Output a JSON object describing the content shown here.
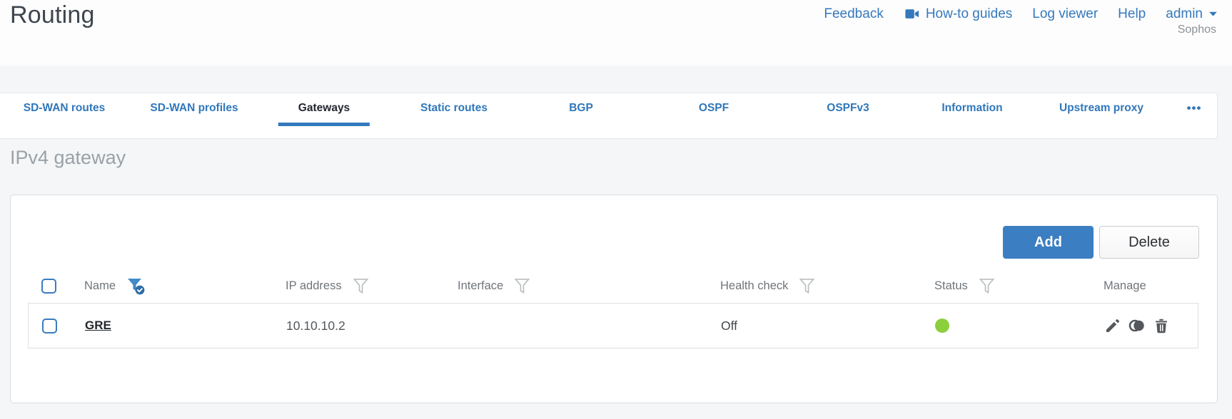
{
  "header": {
    "title": "Routing",
    "nav": {
      "feedback": "Feedback",
      "howto_guides": "How-to guides",
      "log_viewer": "Log viewer",
      "help": "Help",
      "user": "admin",
      "vendor": "Sophos"
    }
  },
  "tabs": {
    "items": [
      {
        "label": "SD-WAN routes",
        "active": false
      },
      {
        "label": "SD-WAN profiles",
        "active": false
      },
      {
        "label": "Gateways",
        "active": true
      },
      {
        "label": "Static routes",
        "active": false
      },
      {
        "label": "BGP",
        "active": false
      },
      {
        "label": "OSPF",
        "active": false
      },
      {
        "label": "OSPFv3",
        "active": false
      },
      {
        "label": "Information",
        "active": false
      },
      {
        "label": "Upstream proxy",
        "active": false
      },
      {
        "label": "•••",
        "active": false
      }
    ]
  },
  "section": {
    "heading": "IPv4 gateway"
  },
  "toolbar": {
    "add": "Add",
    "delete": "Delete"
  },
  "table": {
    "columns": [
      {
        "label": "Name",
        "filter": "active"
      },
      {
        "label": "IP address",
        "filter": "default"
      },
      {
        "label": "Interface",
        "filter": "default"
      },
      {
        "label": "Health check",
        "filter": "default"
      },
      {
        "label": "Status",
        "filter": "default"
      },
      {
        "label": "Manage",
        "filter": "none"
      }
    ],
    "rows": [
      {
        "name": "GRE",
        "ip_address": "10.10.10.2",
        "interface": "",
        "health_check": "Off",
        "status": "up",
        "status_color": "#8bcf3d"
      }
    ]
  },
  "colors": {
    "accent_blue": "#3077ba",
    "button_blue": "#3b7ec2",
    "filter_active_blue": "#4189c9",
    "status_green": "#8bcf3d"
  }
}
